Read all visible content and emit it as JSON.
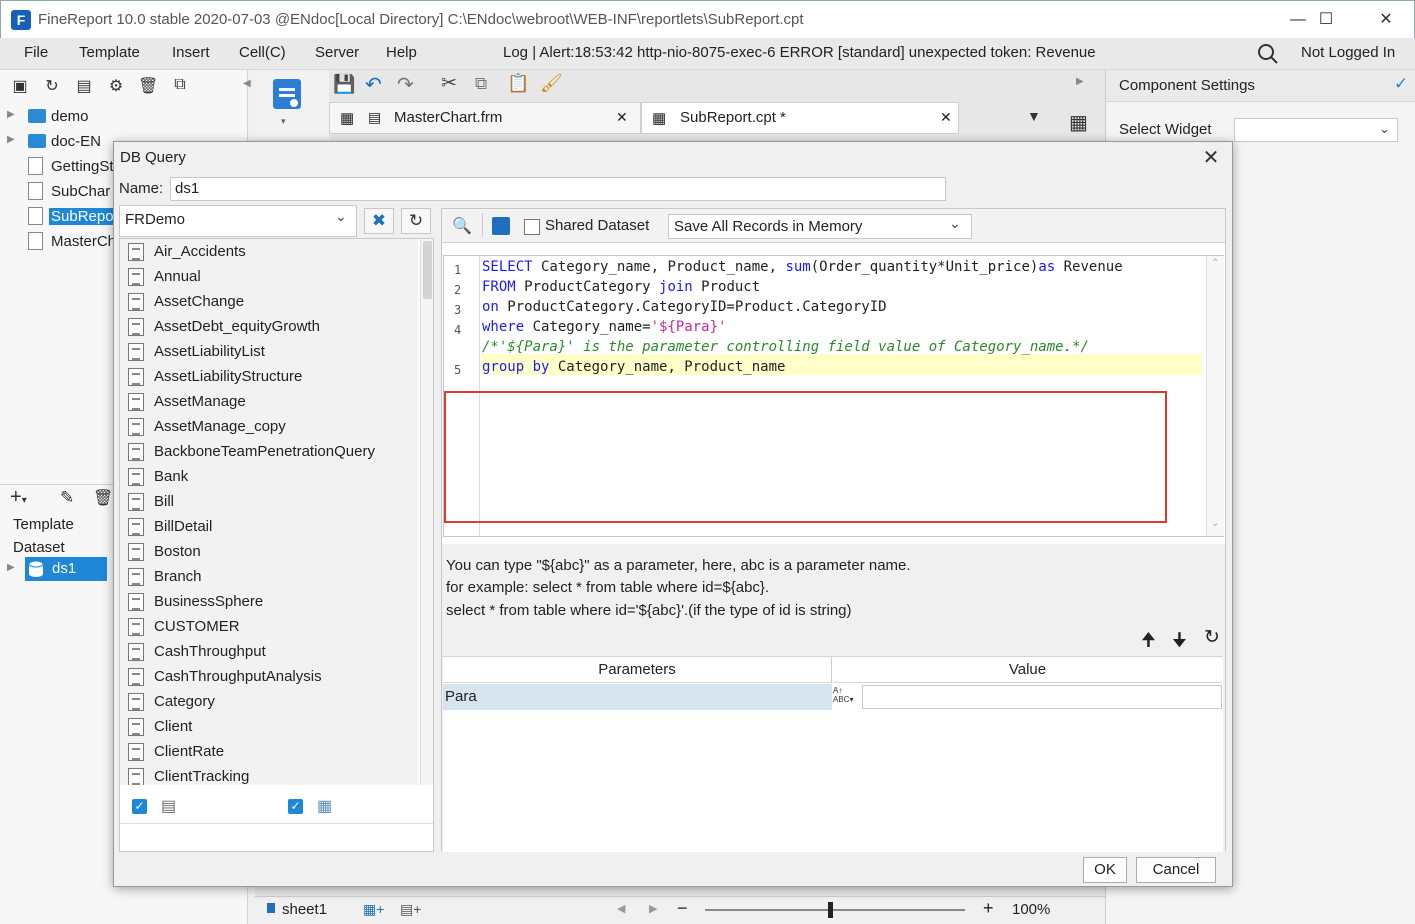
{
  "window": {
    "title": "FineReport 10.0 stable 2020-07-03 @ENdoc[Local Directory]    C:\\ENdoc\\webroot\\WEB-INF\\reportlets\\SubReport.cpt"
  },
  "menu": {
    "items": [
      "File",
      "Template",
      "Insert",
      "Cell(C)",
      "Server",
      "Help"
    ],
    "log": "Log | Alert:18:53:42 http-nio-8075-exec-6 ERROR [standard] unexpected token: Revenue",
    "login": "Not Logged In"
  },
  "tree": {
    "items": [
      {
        "label": "demo",
        "type": "folder"
      },
      {
        "label": "doc-EN",
        "type": "folder"
      },
      {
        "label": "GettingSt",
        "type": "file"
      },
      {
        "label": "SubChar",
        "type": "file"
      },
      {
        "label": "SubRepo",
        "type": "file"
      },
      {
        "label": "MasterCh",
        "type": "file"
      }
    ]
  },
  "dataset_panel": {
    "template_label": "Template",
    "dataset_label": "Dataset",
    "dataset_item": "ds1"
  },
  "tabs": [
    {
      "label": "MasterChart.frm"
    },
    {
      "label": "SubReport.cpt *"
    }
  ],
  "right_panel": {
    "title": "Component Settings",
    "select_widget_label": "Select Widget"
  },
  "bottom": {
    "sheet": "sheet1",
    "zoom": "100%"
  },
  "dialog": {
    "title": "DB Query",
    "name_label": "Name:",
    "name_value": "ds1",
    "connection": "FRDemo",
    "shared_dataset_label": "Shared Dataset",
    "memory_option": "Save All Records in Memory",
    "tables": [
      "Air_Accidents",
      "Annual",
      "AssetChange",
      "AssetDebt_equityGrowth",
      "AssetLiabilityList",
      "AssetLiabilityStructure",
      "AssetManage",
      "AssetManage_copy",
      "BackboneTeamPenetrationQuery",
      "Bank",
      "Bill",
      "BillDetail",
      "Boston",
      "Branch",
      "BusinessSphere",
      "CUSTOMER",
      "CashThroughput",
      "CashThroughputAnalysis",
      "Category",
      "Client",
      "ClientRate",
      "ClientTracking"
    ],
    "line_numbers": [
      "1",
      "2",
      "3",
      "4",
      "5"
    ],
    "sql": {
      "l1_kw": "SELECT",
      "l1_a": " Category_name, Product_name, ",
      "l1_fn": "sum",
      "l1_b": "(Order_quantity*Unit_price)",
      "l1_kw2": "as",
      "l1_c": " Revenue",
      "l2_kw": "FROM",
      "l2_a": " ProductCategory ",
      "l2_kw2": "join",
      "l2_b": " Product",
      "l3_kw": "on",
      "l3_a": " ProductCategory.CategoryID=Product.CategoryID",
      "l4_kw": "where",
      "l4_a": " Category_name=",
      "l4_str": "'${Para}'",
      "l5_cmt": "/*'${Para}' is the parameter controlling field value of Category_name.*/",
      "l6_kw": "group by",
      "l6_a": " Category_name, Product_name"
    },
    "hint_lines": [
      "You can type \"${abc}\" as a parameter, here, abc is a parameter name.",
      "for example: select * from table where id=${abc}.",
      "select * from table where id='${abc}'.(if the type of id is string)"
    ],
    "param_header": "Parameters",
    "value_header": "Value",
    "param_name": "Para",
    "ok": "OK",
    "cancel": "Cancel"
  }
}
